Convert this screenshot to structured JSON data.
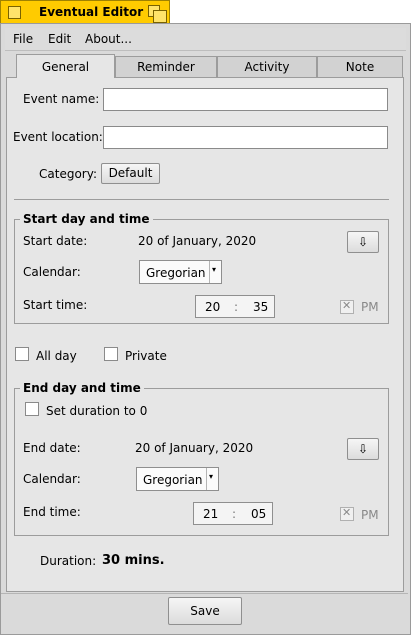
{
  "window": {
    "title": "Eventual Editor"
  },
  "menu": {
    "items": [
      "File",
      "Edit",
      "About..."
    ]
  },
  "tabs": [
    "General",
    "Reminder",
    "Activity",
    "Note"
  ],
  "general": {
    "event_name_label": "Event name:",
    "event_name_value": "",
    "event_location_label": "Event location:",
    "event_location_value": "",
    "category_label": "Category:",
    "category_value": "Default"
  },
  "start": {
    "group_title": "Start day and time",
    "date_label": "Start date:",
    "date_value": "20 of January, 2020",
    "calendar_label": "Calendar:",
    "calendar_value": "Gregorian",
    "time_label": "Start time:",
    "hour": "20",
    "separator": ":",
    "minute": "35",
    "pm_label": "PM",
    "date_button_glyph": "⇩",
    "pm_checked": true
  },
  "options": {
    "all_day_label": "All day",
    "all_day_checked": false,
    "private_label": "Private",
    "private_checked": false
  },
  "end": {
    "group_title": "End day and time",
    "set_duration_label": "Set duration to 0",
    "set_duration_checked": false,
    "date_label": "End date:",
    "date_value": "20 of January, 2020",
    "calendar_label": "Calendar:",
    "calendar_value": "Gregorian",
    "time_label": "End time:",
    "hour": "21",
    "separator": ":",
    "minute": "05",
    "pm_label": "PM",
    "date_button_glyph": "⇩",
    "pm_checked": true
  },
  "duration": {
    "label": "Duration:",
    "value": "30 mins."
  },
  "actions": {
    "save_label": "Save"
  },
  "icons": {
    "popup_arrow": "▾",
    "check_mark": "✕"
  },
  "colors": {
    "title_tab": "#ffcb00",
    "window_bg": "#dadada",
    "panel_bg": "#e6e6e6"
  }
}
